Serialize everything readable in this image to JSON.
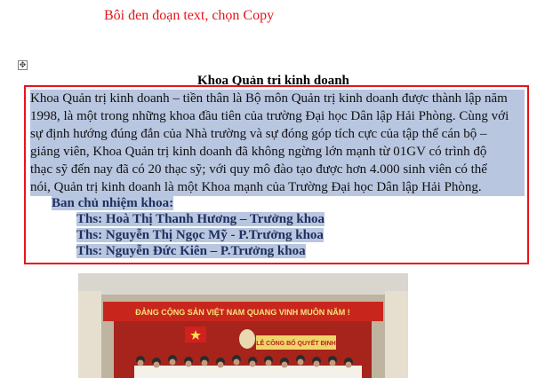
{
  "instruction": "Bôi đen đoạn text, chọn Copy",
  "heading": "Khoa Quản trị kinh doanh",
  "paragraph_lines": [
    "Khoa Quản trị kinh doanh – tiền thân là Bộ môn Quản trị kinh doanh được thành lập năm",
    "1998, là một trong những khoa đầu tiên của trường Đại học Dân lập Hải Phòng. Cùng với",
    "sự định hướng đúng đắn của Nhà trường và sự đóng góp tích cực của tập thể cán bộ –",
    "giảng viên, Khoa Quản trị kinh doanh đã không ngừng lớn mạnh từ 01GV có trình độ",
    "thạc sỹ đến nay đã có 20 thạc sỹ; với quy mô đào tạo được hơn 4.000 sinh viên có thể",
    "nói, Quản trị kinh doanh là một Khoa mạnh của Trường Đại học Dân lập Hải Phòng."
  ],
  "board": {
    "title": "Ban chủ nhiệm khoa:",
    "members": [
      "Ths:  Hoà Thị Thanh Hương – Trưởng khoa",
      "Ths:  Nguyễn Thị Ngọc Mỹ - P.Trưởng khoa",
      "Ths: Nguyễn Đức Kiên – P.Trưởng khoa"
    ]
  },
  "photo": {
    "banner_text": "ĐẢNG CỘNG SẢN VIỆT NAM QUANG VINH MUÔN NĂM !",
    "sign_text": "LỄ CÔNG BỐ QUYẾT ĐỊNH"
  },
  "colors": {
    "selection": "#b8c6e0",
    "red": "#e8141b",
    "navy_text": "#1f2f5f"
  }
}
